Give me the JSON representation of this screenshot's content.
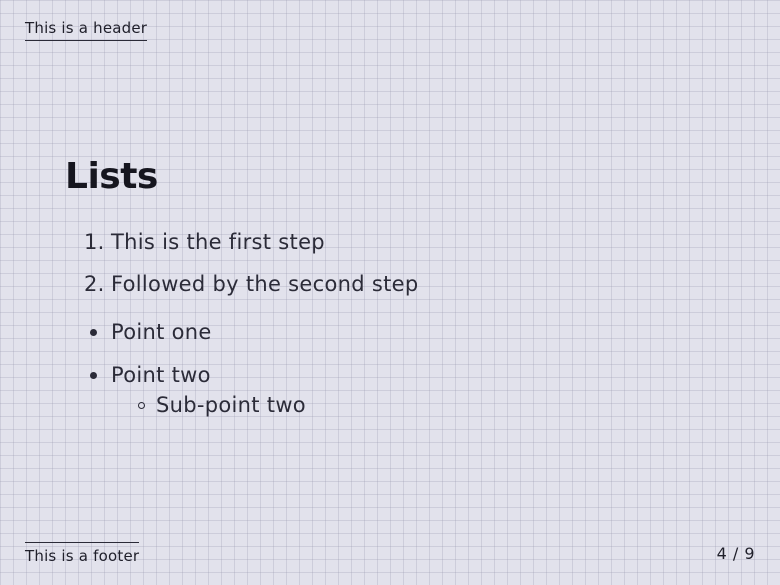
{
  "header": {
    "text": "This is a header"
  },
  "title": "Lists",
  "ordered_list": [
    {
      "number": "1.",
      "text": "This is the first step"
    },
    {
      "number": "2.",
      "text": "Followed by the second step"
    }
  ],
  "bullet_list": [
    {
      "text": "Point one",
      "subitems": []
    },
    {
      "text": "Point two",
      "subitems": [
        {
          "text": "Sub-point two"
        }
      ]
    }
  ],
  "footer": {
    "text": "This is a footer"
  },
  "pagination": {
    "current": "4",
    "separator": "/",
    "total": "9",
    "label": "4 / 9"
  }
}
